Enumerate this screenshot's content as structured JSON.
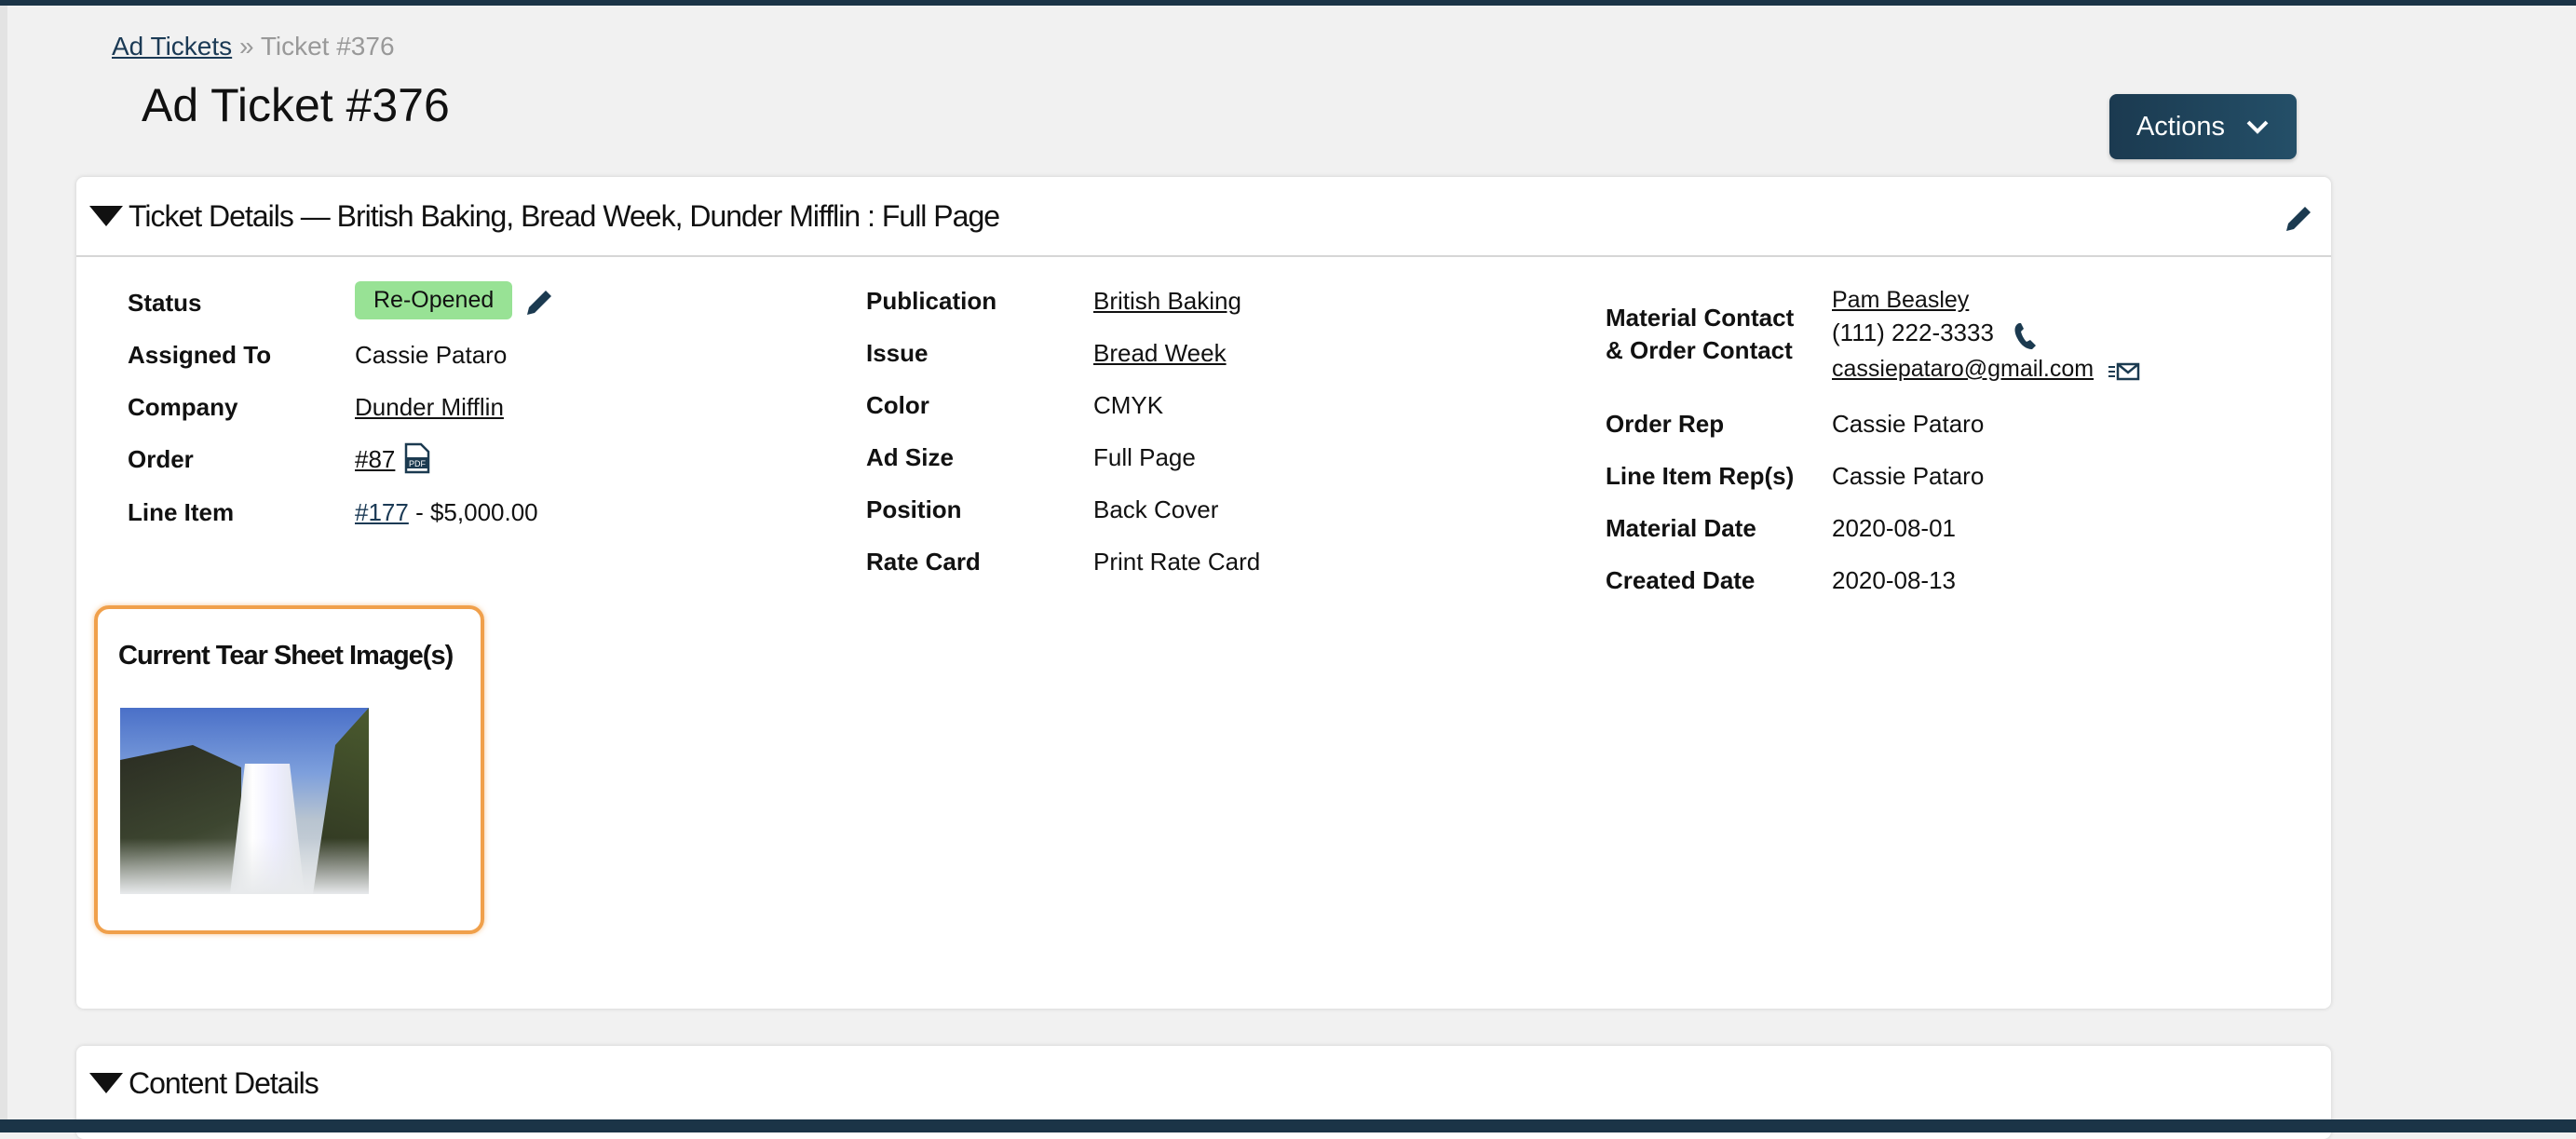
{
  "breadcrumb": {
    "parent": "Ad Tickets",
    "separator": "»",
    "current": "Ticket #376"
  },
  "page_title": "Ad Ticket #376",
  "actions_label": "Actions",
  "ticket_details": {
    "header": "Ticket Details — British Baking, Bread Week, Dunder Mifflin : Full Page",
    "status_label": "Status",
    "status": "Re-Opened",
    "status_color": "#98e295",
    "assigned_label": "Assigned To",
    "assigned": "Cassie Pataro",
    "company_label": "Company",
    "company": "Dunder Mifflin",
    "order_label": "Order",
    "order": "#87",
    "line_item_label": "Line Item",
    "line_item": "#177",
    "line_item_amount": "- $5,000.00",
    "publication_label": "Publication",
    "publication": "British Baking",
    "issue_label": "Issue",
    "issue": "Bread Week",
    "color_label": "Color",
    "color": "CMYK",
    "ad_size_label": "Ad Size",
    "ad_size": "Full Page",
    "position_label": "Position",
    "position": "Back Cover",
    "rate_card_label": "Rate Card",
    "rate_card": "Print Rate Card",
    "contact_label_1": "Material Contact",
    "contact_label_2": "& Order Contact",
    "contact_name": "Pam Beasley",
    "contact_phone": "(111) 222-3333",
    "contact_email": "cassiepataro@gmail.com",
    "order_rep_label": "Order Rep",
    "order_rep": "Cassie Pataro",
    "line_item_reps_label": "Line Item Rep(s)",
    "line_item_reps": "Cassie Pataro",
    "material_date_label": "Material Date",
    "material_date": "2020-08-01",
    "created_date_label": "Created Date",
    "created_date": "2020-08-13",
    "tear_sheet_title": "Current Tear Sheet Image(s)"
  },
  "content_details": {
    "header": "Content Details"
  }
}
